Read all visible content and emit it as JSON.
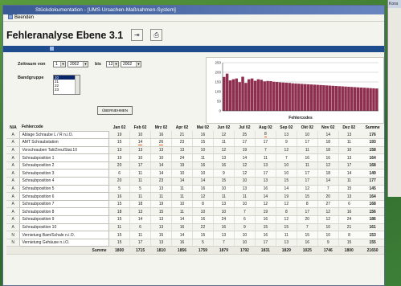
{
  "window": {
    "title": "Stückdokumentation - [UMS Ursachen-Maßnahmen-System]"
  },
  "menu": {
    "items": [
      "Beenden"
    ]
  },
  "header": {
    "title": "Fehleranalyse Ebene 3.1"
  },
  "background_window": {
    "title": "Kons"
  },
  "filter": {
    "zeitraum_label": "Zeitraum von",
    "from_month": "1",
    "from_year": "2002",
    "bis_label": "bis",
    "to_month": "12",
    "to_year": "2002",
    "bandgruppe_label": "Bandgruppe",
    "bandgruppe_options": [
      "20",
      "21",
      "22",
      "23"
    ],
    "bandgruppe_selected": "20",
    "apply_button": "ÜBERNEHMEN"
  },
  "chart_data": {
    "type": "bar",
    "xlabel": "Fehlercodes",
    "ylim": [
      0,
      250
    ],
    "yticks": [
      0,
      50,
      100,
      150,
      200,
      250
    ],
    "values": [
      176,
      193,
      158,
      164,
      168,
      149,
      177,
      145,
      164,
      168,
      156,
      164,
      161,
      153,
      155,
      154,
      151,
      150,
      148,
      147,
      146,
      145,
      143,
      142,
      141,
      140,
      139,
      138,
      137,
      136,
      135,
      134,
      133,
      132,
      131,
      130,
      129,
      128,
      127,
      126,
      125,
      124,
      123,
      122,
      121,
      120,
      119,
      118,
      117,
      116
    ]
  },
  "table": {
    "columns": [
      "N/A",
      "Fehlercode",
      "Jan 02",
      "Feb 02",
      "Mrz 02",
      "Apr 02",
      "Mai 02",
      "Jun 02",
      "Jul 02",
      "Aug 02",
      "Sep 02",
      "Okt 02",
      "Nov 02",
      "Dez 02",
      "Summe"
    ],
    "rows": [
      {
        "na": "A",
        "code": "Ablage Schraube L / R n.i.O.",
        "vals": [
          "19",
          "10",
          "16",
          "21",
          "16",
          "12",
          "25",
          "8",
          "13",
          "10",
          "14",
          "13"
        ],
        "sum": "176"
      },
      {
        "na": "A",
        "code": "AMT Schraubstation",
        "vals": [
          "15",
          "14",
          "26",
          "23",
          "15",
          "11",
          "17",
          "17",
          "9",
          "17",
          "18",
          "11"
        ],
        "sum": "193"
      },
      {
        "na": "A",
        "code": "Vorschrauben Tali/Zreu/Stat.10",
        "vals": [
          "13",
          "13",
          "13",
          "13",
          "10",
          "12",
          "19",
          "7",
          "12",
          "11",
          "18",
          "10"
        ],
        "sum": "158"
      },
      {
        "na": "A",
        "code": "Schraubposition 1",
        "vals": [
          "19",
          "10",
          "10",
          "24",
          "11",
          "13",
          "14",
          "11",
          "7",
          "16",
          "16",
          "13"
        ],
        "sum": "164"
      },
      {
        "na": "A",
        "code": "Schraubposition 2",
        "vals": [
          "20",
          "17",
          "14",
          "19",
          "16",
          "16",
          "12",
          "13",
          "10",
          "11",
          "12",
          "17"
        ],
        "sum": "168"
      },
      {
        "na": "A",
        "code": "Schraubposition 3",
        "vals": [
          "6",
          "11",
          "14",
          "10",
          "10",
          "9",
          "12",
          "17",
          "10",
          "17",
          "18",
          "14"
        ],
        "sum": "149"
      },
      {
        "na": "A",
        "code": "Schraubposition 4",
        "vals": [
          "20",
          "11",
          "23",
          "14",
          "14",
          "15",
          "10",
          "13",
          "15",
          "17",
          "14",
          "11"
        ],
        "sum": "177"
      },
      {
        "na": "A",
        "code": "Schraubposition 5",
        "vals": [
          "5",
          "5",
          "13",
          "11",
          "16",
          "10",
          "13",
          "16",
          "14",
          "12",
          "7",
          "15"
        ],
        "sum": "145"
      },
      {
        "na": "A",
        "code": "Schraubposition 6",
        "vals": [
          "16",
          "11",
          "11",
          "11",
          "12",
          "11",
          "11",
          "14",
          "19",
          "15",
          "20",
          "13"
        ],
        "sum": "164"
      },
      {
        "na": "A",
        "code": "Schraubposition 7",
        "vals": [
          "15",
          "18",
          "19",
          "10",
          "8",
          "13",
          "10",
          "12",
          "12",
          "8",
          "27",
          "6"
        ],
        "sum": "168"
      },
      {
        "na": "A",
        "code": "Schraubposition 8",
        "vals": [
          "18",
          "13",
          "15",
          "11",
          "10",
          "10",
          "7",
          "19",
          "8",
          "17",
          "12",
          "16"
        ],
        "sum": "156"
      },
      {
        "na": "A",
        "code": "Schraubposition 9",
        "vals": [
          "15",
          "14",
          "13",
          "14",
          "16",
          "24",
          "6",
          "16",
          "12",
          "20",
          "12",
          "24"
        ],
        "sum": "186"
      },
      {
        "na": "A",
        "code": "Schraubposition 10",
        "vals": [
          "11",
          "6",
          "13",
          "16",
          "22",
          "16",
          "9",
          "15",
          "15",
          "7",
          "10",
          "21"
        ],
        "sum": "161"
      },
      {
        "na": "N",
        "code": "Vernietung Bam/Schale n.i.O.",
        "vals": [
          "15",
          "11",
          "15",
          "14",
          "15",
          "13",
          "10",
          "16",
          "11",
          "15",
          "10",
          "8"
        ],
        "sum": "153"
      },
      {
        "na": "N",
        "code": "Vernietung Gehäuse n.i.O.",
        "vals": [
          "15",
          "17",
          "13",
          "16",
          "5",
          "7",
          "10",
          "17",
          "13",
          "16",
          "9",
          "15"
        ],
        "sum": "155"
      }
    ],
    "total": {
      "label": "Summe",
      "vals": [
        "1800",
        "1715",
        "1810",
        "1856",
        "1759",
        "1879",
        "1792",
        "1831",
        "1829",
        "1025",
        "1746",
        "1800"
      ],
      "sum": "21650"
    }
  }
}
